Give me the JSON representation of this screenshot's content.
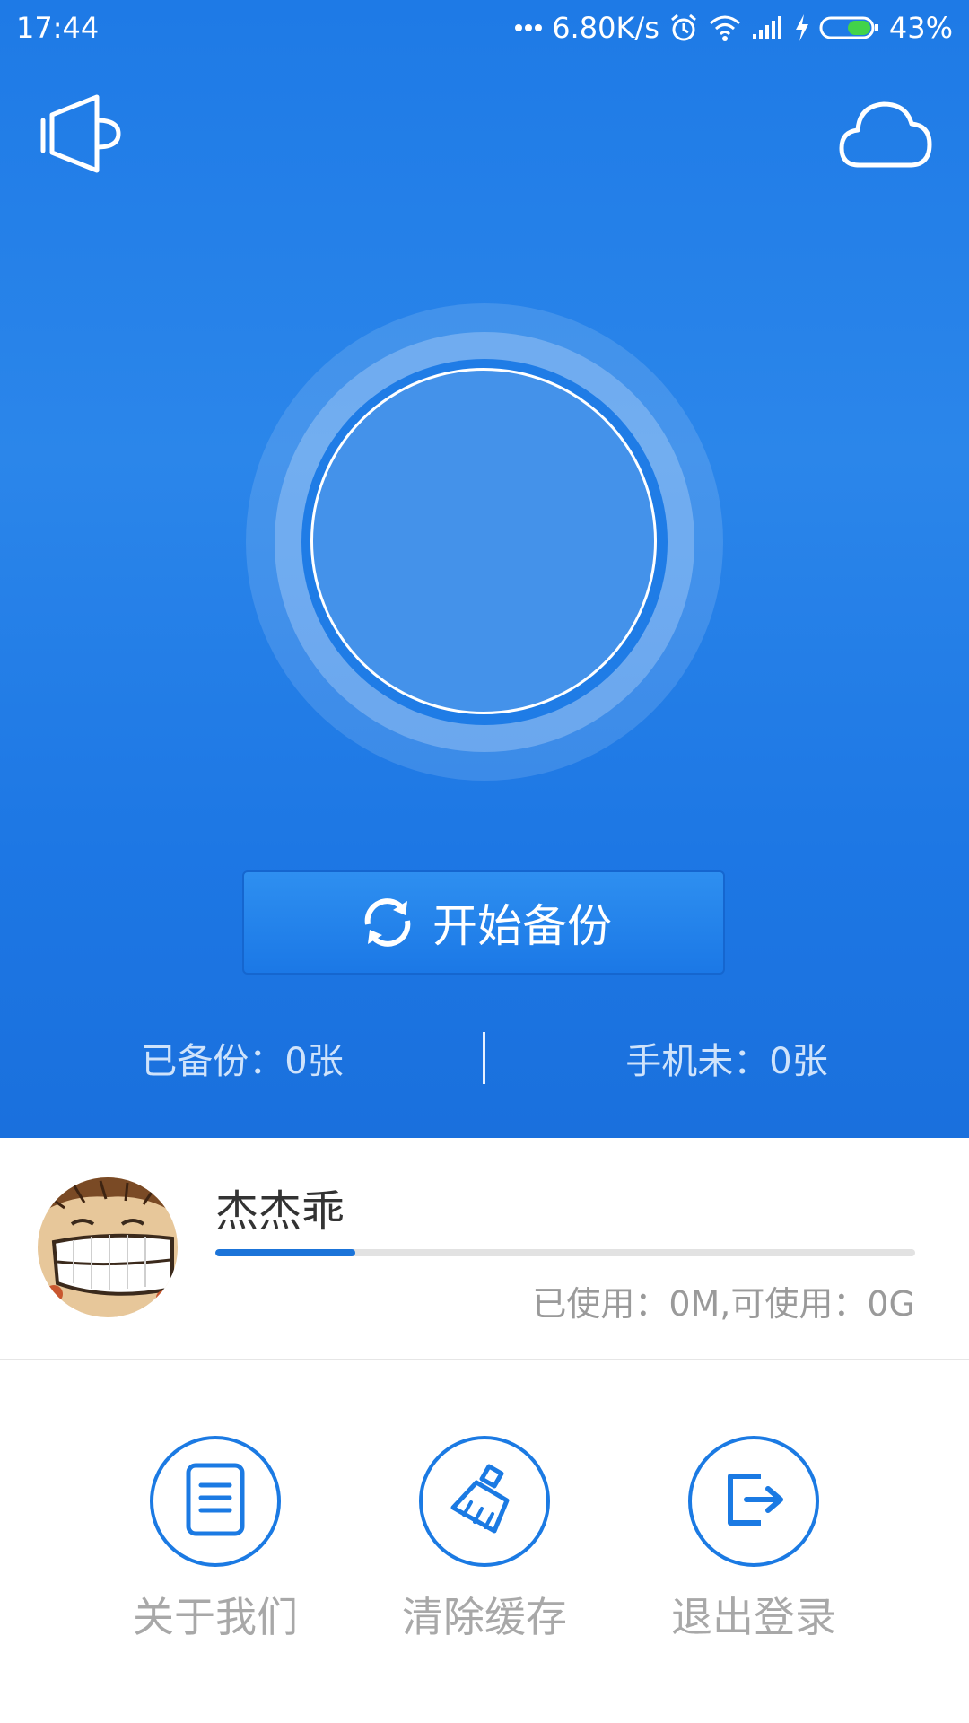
{
  "status_bar": {
    "time": "17:44",
    "network_speed": "6.80K/s",
    "battery_percent": "43%",
    "battery_level": 0.43,
    "icons": [
      "dots-icon",
      "alarm-icon",
      "wifi-icon",
      "signal-icon",
      "charging-icon",
      "battery-icon"
    ]
  },
  "header": {
    "left_icon": "speaker-icon",
    "right_icon": "cloud-icon"
  },
  "backup": {
    "start_label": "开始备份",
    "start_icon": "sync-icon",
    "backed_up_label": "已备份：0张",
    "phone_not_backed_label": "手机未：0张"
  },
  "user": {
    "name": "杰杰乖",
    "usage_text": "已使用：0M,可使用：0G",
    "usage_fraction": 0.2
  },
  "actions": [
    {
      "label": "关于我们",
      "icon": "document-icon"
    },
    {
      "label": "清除缓存",
      "icon": "broom-icon"
    },
    {
      "label": "退出登录",
      "icon": "logout-icon"
    }
  ],
  "colors": {
    "primary_blue": "#1e7ae6",
    "accent_blue": "#1b7ae3",
    "label_gray": "#a8a8a8"
  }
}
